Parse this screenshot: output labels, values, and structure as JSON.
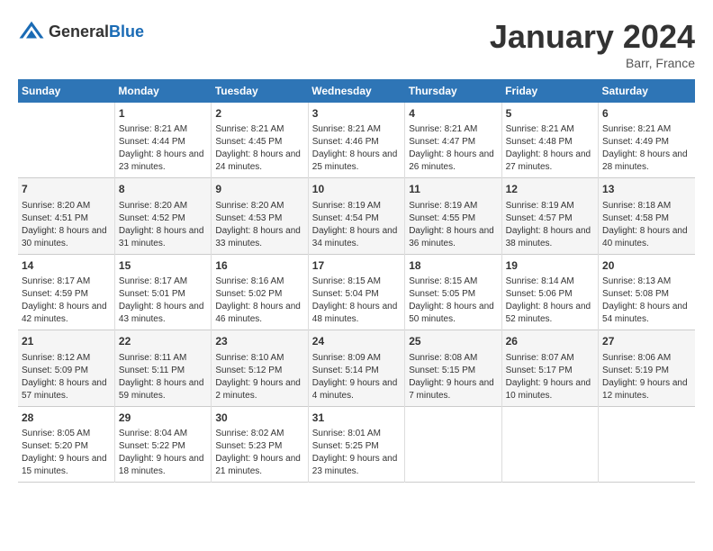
{
  "header": {
    "logo": {
      "general": "General",
      "blue": "Blue"
    },
    "title": "January 2024",
    "location": "Barr, France"
  },
  "weekdays": [
    "Sunday",
    "Monday",
    "Tuesday",
    "Wednesday",
    "Thursday",
    "Friday",
    "Saturday"
  ],
  "weeks": [
    [
      {
        "day": "",
        "sunrise": "",
        "sunset": "",
        "daylight": ""
      },
      {
        "day": "1",
        "sunrise": "Sunrise: 8:21 AM",
        "sunset": "Sunset: 4:44 PM",
        "daylight": "Daylight: 8 hours and 23 minutes."
      },
      {
        "day": "2",
        "sunrise": "Sunrise: 8:21 AM",
        "sunset": "Sunset: 4:45 PM",
        "daylight": "Daylight: 8 hours and 24 minutes."
      },
      {
        "day": "3",
        "sunrise": "Sunrise: 8:21 AM",
        "sunset": "Sunset: 4:46 PM",
        "daylight": "Daylight: 8 hours and 25 minutes."
      },
      {
        "day": "4",
        "sunrise": "Sunrise: 8:21 AM",
        "sunset": "Sunset: 4:47 PM",
        "daylight": "Daylight: 8 hours and 26 minutes."
      },
      {
        "day": "5",
        "sunrise": "Sunrise: 8:21 AM",
        "sunset": "Sunset: 4:48 PM",
        "daylight": "Daylight: 8 hours and 27 minutes."
      },
      {
        "day": "6",
        "sunrise": "Sunrise: 8:21 AM",
        "sunset": "Sunset: 4:49 PM",
        "daylight": "Daylight: 8 hours and 28 minutes."
      }
    ],
    [
      {
        "day": "7",
        "sunrise": "Sunrise: 8:20 AM",
        "sunset": "Sunset: 4:51 PM",
        "daylight": "Daylight: 8 hours and 30 minutes."
      },
      {
        "day": "8",
        "sunrise": "Sunrise: 8:20 AM",
        "sunset": "Sunset: 4:52 PM",
        "daylight": "Daylight: 8 hours and 31 minutes."
      },
      {
        "day": "9",
        "sunrise": "Sunrise: 8:20 AM",
        "sunset": "Sunset: 4:53 PM",
        "daylight": "Daylight: 8 hours and 33 minutes."
      },
      {
        "day": "10",
        "sunrise": "Sunrise: 8:19 AM",
        "sunset": "Sunset: 4:54 PM",
        "daylight": "Daylight: 8 hours and 34 minutes."
      },
      {
        "day": "11",
        "sunrise": "Sunrise: 8:19 AM",
        "sunset": "Sunset: 4:55 PM",
        "daylight": "Daylight: 8 hours and 36 minutes."
      },
      {
        "day": "12",
        "sunrise": "Sunrise: 8:19 AM",
        "sunset": "Sunset: 4:57 PM",
        "daylight": "Daylight: 8 hours and 38 minutes."
      },
      {
        "day": "13",
        "sunrise": "Sunrise: 8:18 AM",
        "sunset": "Sunset: 4:58 PM",
        "daylight": "Daylight: 8 hours and 40 minutes."
      }
    ],
    [
      {
        "day": "14",
        "sunrise": "Sunrise: 8:17 AM",
        "sunset": "Sunset: 4:59 PM",
        "daylight": "Daylight: 8 hours and 42 minutes."
      },
      {
        "day": "15",
        "sunrise": "Sunrise: 8:17 AM",
        "sunset": "Sunset: 5:01 PM",
        "daylight": "Daylight: 8 hours and 43 minutes."
      },
      {
        "day": "16",
        "sunrise": "Sunrise: 8:16 AM",
        "sunset": "Sunset: 5:02 PM",
        "daylight": "Daylight: 8 hours and 46 minutes."
      },
      {
        "day": "17",
        "sunrise": "Sunrise: 8:15 AM",
        "sunset": "Sunset: 5:04 PM",
        "daylight": "Daylight: 8 hours and 48 minutes."
      },
      {
        "day": "18",
        "sunrise": "Sunrise: 8:15 AM",
        "sunset": "Sunset: 5:05 PM",
        "daylight": "Daylight: 8 hours and 50 minutes."
      },
      {
        "day": "19",
        "sunrise": "Sunrise: 8:14 AM",
        "sunset": "Sunset: 5:06 PM",
        "daylight": "Daylight: 8 hours and 52 minutes."
      },
      {
        "day": "20",
        "sunrise": "Sunrise: 8:13 AM",
        "sunset": "Sunset: 5:08 PM",
        "daylight": "Daylight: 8 hours and 54 minutes."
      }
    ],
    [
      {
        "day": "21",
        "sunrise": "Sunrise: 8:12 AM",
        "sunset": "Sunset: 5:09 PM",
        "daylight": "Daylight: 8 hours and 57 minutes."
      },
      {
        "day": "22",
        "sunrise": "Sunrise: 8:11 AM",
        "sunset": "Sunset: 5:11 PM",
        "daylight": "Daylight: 8 hours and 59 minutes."
      },
      {
        "day": "23",
        "sunrise": "Sunrise: 8:10 AM",
        "sunset": "Sunset: 5:12 PM",
        "daylight": "Daylight: 9 hours and 2 minutes."
      },
      {
        "day": "24",
        "sunrise": "Sunrise: 8:09 AM",
        "sunset": "Sunset: 5:14 PM",
        "daylight": "Daylight: 9 hours and 4 minutes."
      },
      {
        "day": "25",
        "sunrise": "Sunrise: 8:08 AM",
        "sunset": "Sunset: 5:15 PM",
        "daylight": "Daylight: 9 hours and 7 minutes."
      },
      {
        "day": "26",
        "sunrise": "Sunrise: 8:07 AM",
        "sunset": "Sunset: 5:17 PM",
        "daylight": "Daylight: 9 hours and 10 minutes."
      },
      {
        "day": "27",
        "sunrise": "Sunrise: 8:06 AM",
        "sunset": "Sunset: 5:19 PM",
        "daylight": "Daylight: 9 hours and 12 minutes."
      }
    ],
    [
      {
        "day": "28",
        "sunrise": "Sunrise: 8:05 AM",
        "sunset": "Sunset: 5:20 PM",
        "daylight": "Daylight: 9 hours and 15 minutes."
      },
      {
        "day": "29",
        "sunrise": "Sunrise: 8:04 AM",
        "sunset": "Sunset: 5:22 PM",
        "daylight": "Daylight: 9 hours and 18 minutes."
      },
      {
        "day": "30",
        "sunrise": "Sunrise: 8:02 AM",
        "sunset": "Sunset: 5:23 PM",
        "daylight": "Daylight: 9 hours and 21 minutes."
      },
      {
        "day": "31",
        "sunrise": "Sunrise: 8:01 AM",
        "sunset": "Sunset: 5:25 PM",
        "daylight": "Daylight: 9 hours and 23 minutes."
      },
      {
        "day": "",
        "sunrise": "",
        "sunset": "",
        "daylight": ""
      },
      {
        "day": "",
        "sunrise": "",
        "sunset": "",
        "daylight": ""
      },
      {
        "day": "",
        "sunrise": "",
        "sunset": "",
        "daylight": ""
      }
    ]
  ]
}
